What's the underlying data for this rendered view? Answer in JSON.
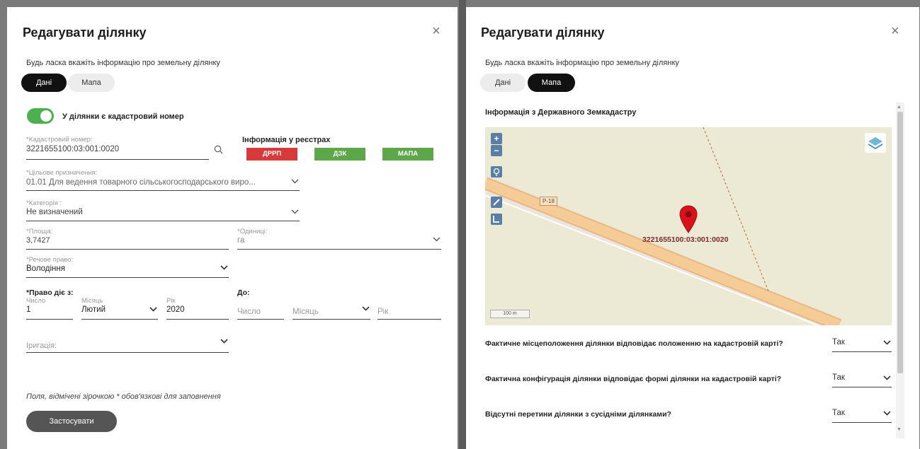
{
  "left": {
    "title": "Редагувати ділянку",
    "close": "×",
    "subtitle": "Будь ласка вкажіть інформацію про земельну ділянку",
    "tabs": {
      "data": "Дані",
      "map": "Мапа"
    },
    "toggle_label": "У ділянки є кадастровий номер",
    "cadastral": {
      "label": "*Кадастровий номер:",
      "value": "3221655100:03:001:0020"
    },
    "registries": {
      "title": "Інформація у реєстрах",
      "btn1": "ДРРП",
      "btn2": "ДЗК",
      "btn3": "МАПА",
      "btn1_color": "#d63a3a",
      "btn2_color": "#5ea64a",
      "btn3_color": "#5ea64a"
    },
    "purpose": {
      "label": "*Цільове призначення:",
      "value": "01.01 Для ведення товарного сільськогосподарського виро..."
    },
    "category": {
      "label": "*Категорія :",
      "value": "Не визначений"
    },
    "area": {
      "label": "*Площа:",
      "value": "3,7427"
    },
    "units": {
      "label": "*Одиниці:",
      "value": "га"
    },
    "right_type": {
      "label": "*Речове право:",
      "value": "Володіння"
    },
    "from": {
      "title": "*Право діє з:",
      "day_label": "Число",
      "day_value": "1",
      "month_label": "Місяць",
      "month_value": "Лютий",
      "year_label": "Рік",
      "year_value": "2020"
    },
    "to": {
      "title": "До:",
      "day_placeholder": "Число",
      "month_placeholder": "Місяць",
      "year_placeholder": "Рік"
    },
    "irrigation": {
      "placeholder": "Іригація:"
    },
    "note": "Поля, відмічені зірочкою * обов'язкові для заповнення",
    "apply": "Застосувати"
  },
  "right": {
    "title": "Редагувати ділянку",
    "close": "×",
    "subtitle": "Будь ласка вкажіть інформацію про земельну ділянку",
    "tabs": {
      "data": "Дані",
      "map": "Мапа"
    },
    "section_title": "Інформація з Державного Земкадастру",
    "map": {
      "zoom_in": "+",
      "zoom_out": "−",
      "road_label": "Р-18",
      "parcel_label": "3221655100:03:001:0020",
      "scale": "100 m"
    },
    "questions": [
      {
        "text": "Фактичне місцеположення ділянки відповідає положенню на кадастровій карті?",
        "answer": "Так"
      },
      {
        "text": "Фактична конфігурація ділянки відповідає формі ділянки на кадастровій карті?",
        "answer": "Так"
      },
      {
        "text": "Відсутні перетини ділянки з сусідніми ділянками?",
        "answer": "Так"
      }
    ]
  }
}
